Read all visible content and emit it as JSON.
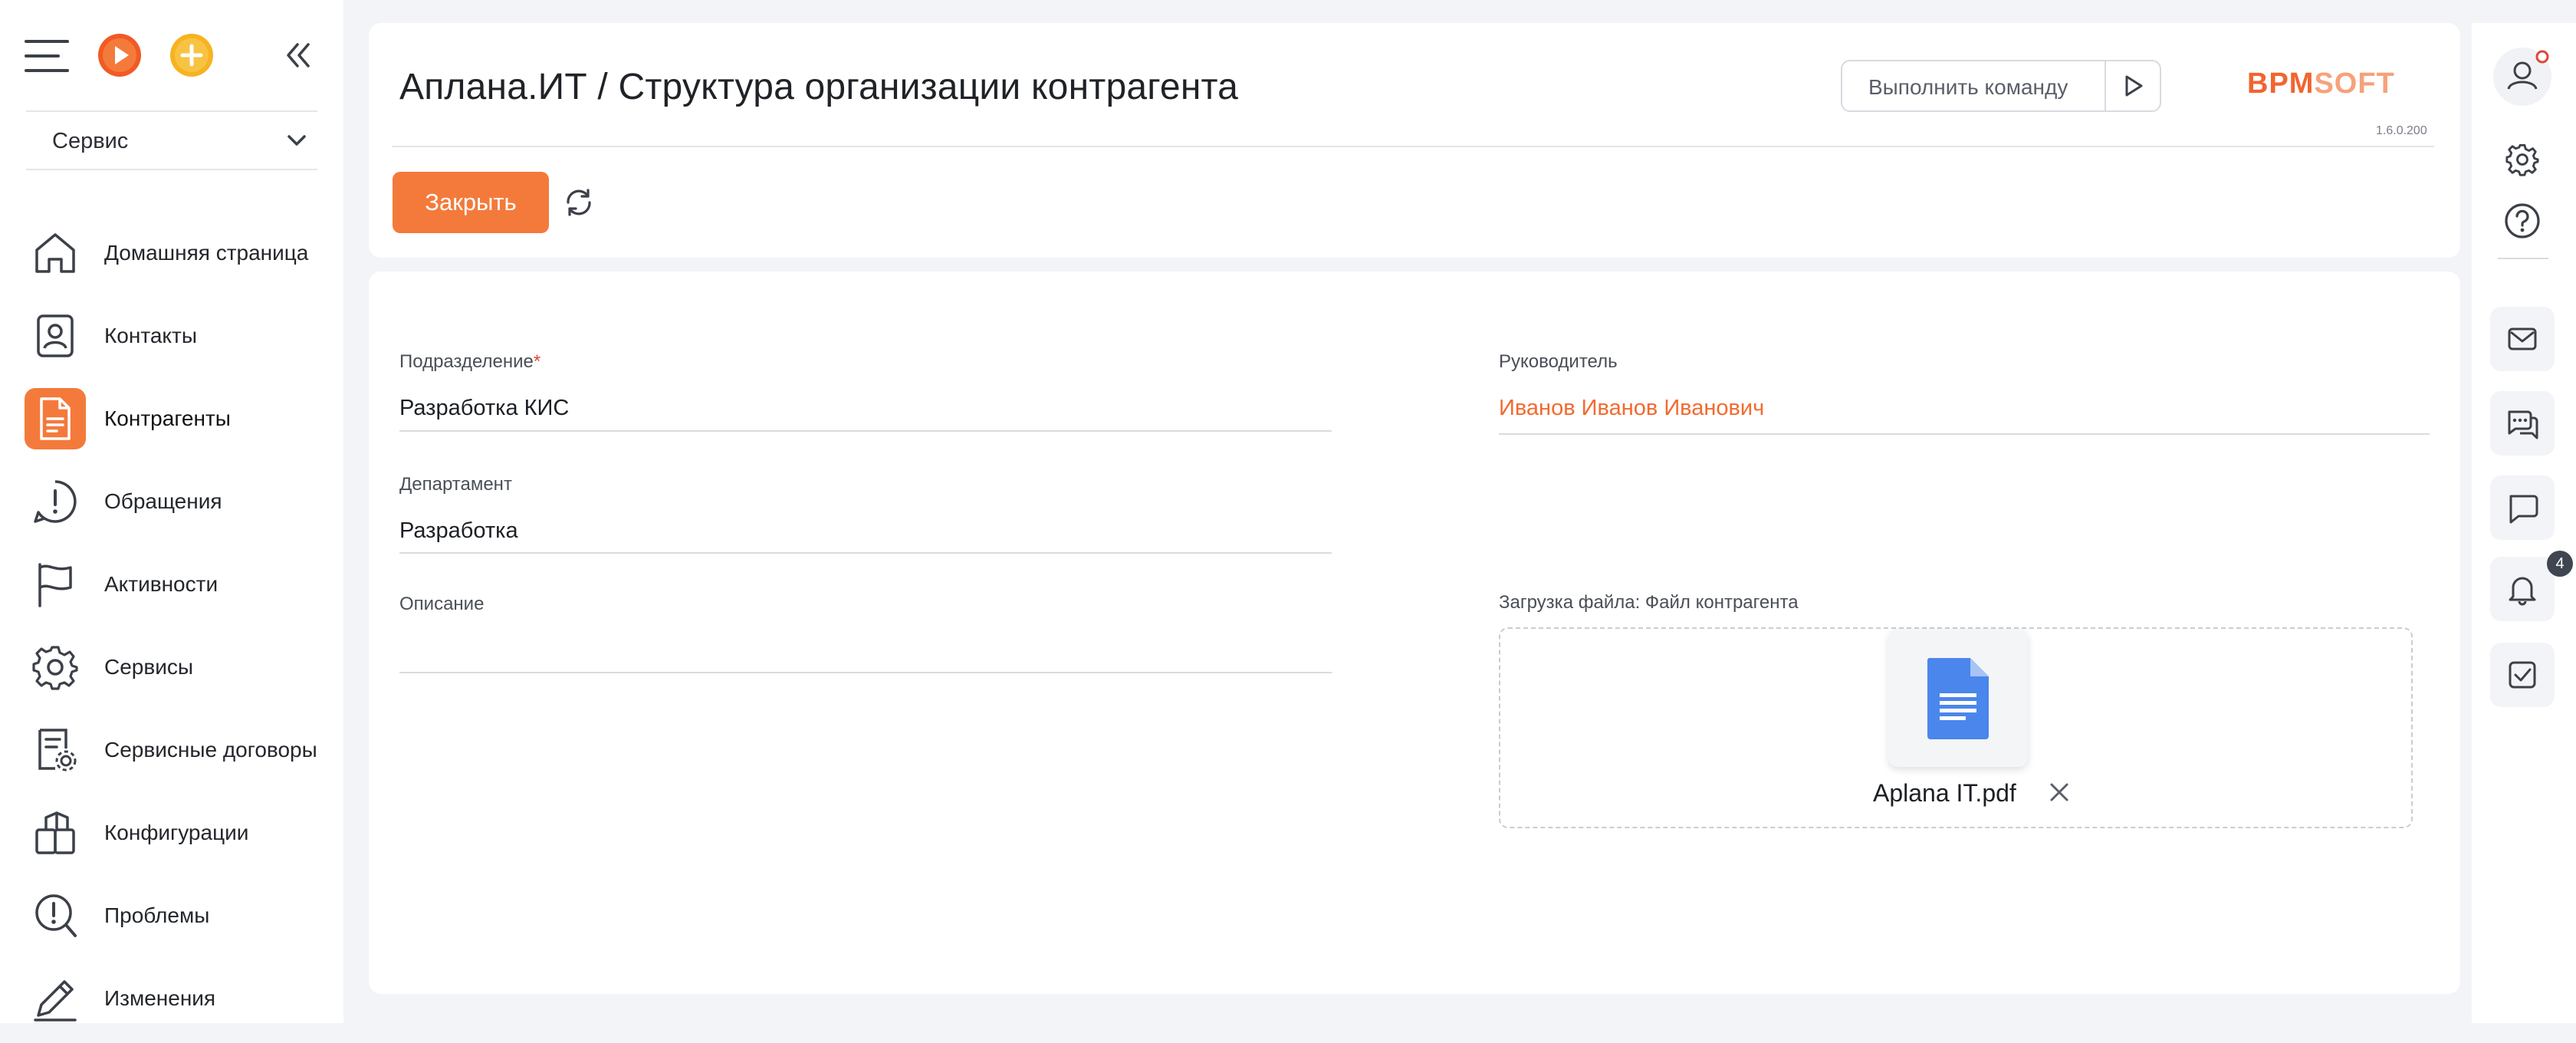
{
  "workspace": {
    "label": "Сервис"
  },
  "nav": [
    {
      "id": "home",
      "label": "Домашняя страница",
      "icon": "home-icon"
    },
    {
      "id": "contacts",
      "label": "Контакты",
      "icon": "contact-card-icon"
    },
    {
      "id": "accounts",
      "label": "Контрагенты",
      "icon": "document-icon",
      "active": true
    },
    {
      "id": "cases",
      "label": "Обращения",
      "icon": "alert-circle-icon"
    },
    {
      "id": "activities",
      "label": "Активности",
      "icon": "flag-icon"
    },
    {
      "id": "services",
      "label": "Сервисы",
      "icon": "gear-icon"
    },
    {
      "id": "service-contracts",
      "label": "Сервисные договоры",
      "icon": "contract-gear-icon"
    },
    {
      "id": "configurations",
      "label": "Конфигурации",
      "icon": "config-boxes-icon"
    },
    {
      "id": "problems",
      "label": "Проблемы",
      "icon": "problem-search-icon"
    },
    {
      "id": "changes",
      "label": "Изменения",
      "icon": "pencil-icon"
    }
  ],
  "header": {
    "title": "Аплана.ИТ / Структура организации контрагента",
    "command_placeholder": "Выполнить команду",
    "logo_part_a": "BPM",
    "logo_part_b": "SOFT",
    "version": "1.6.0.200",
    "close_label": "Закрыть"
  },
  "form": {
    "division_label": "Подразделение",
    "required_mark": "*",
    "division_value": "Разработка КИС",
    "manager_label": "Руководитель",
    "manager_value": "Иванов Иванов Иванович",
    "department_label": "Департамент",
    "department_value": "Разработка",
    "description_label": "Описание",
    "description_value": "",
    "upload_label": "Загрузка файла: Файл контрагента",
    "file_name": "Aplana IT.pdf"
  },
  "rail": {
    "notifications_count": "4"
  },
  "colors": {
    "accent": "#f47a3b",
    "link": "#f26a2f"
  }
}
